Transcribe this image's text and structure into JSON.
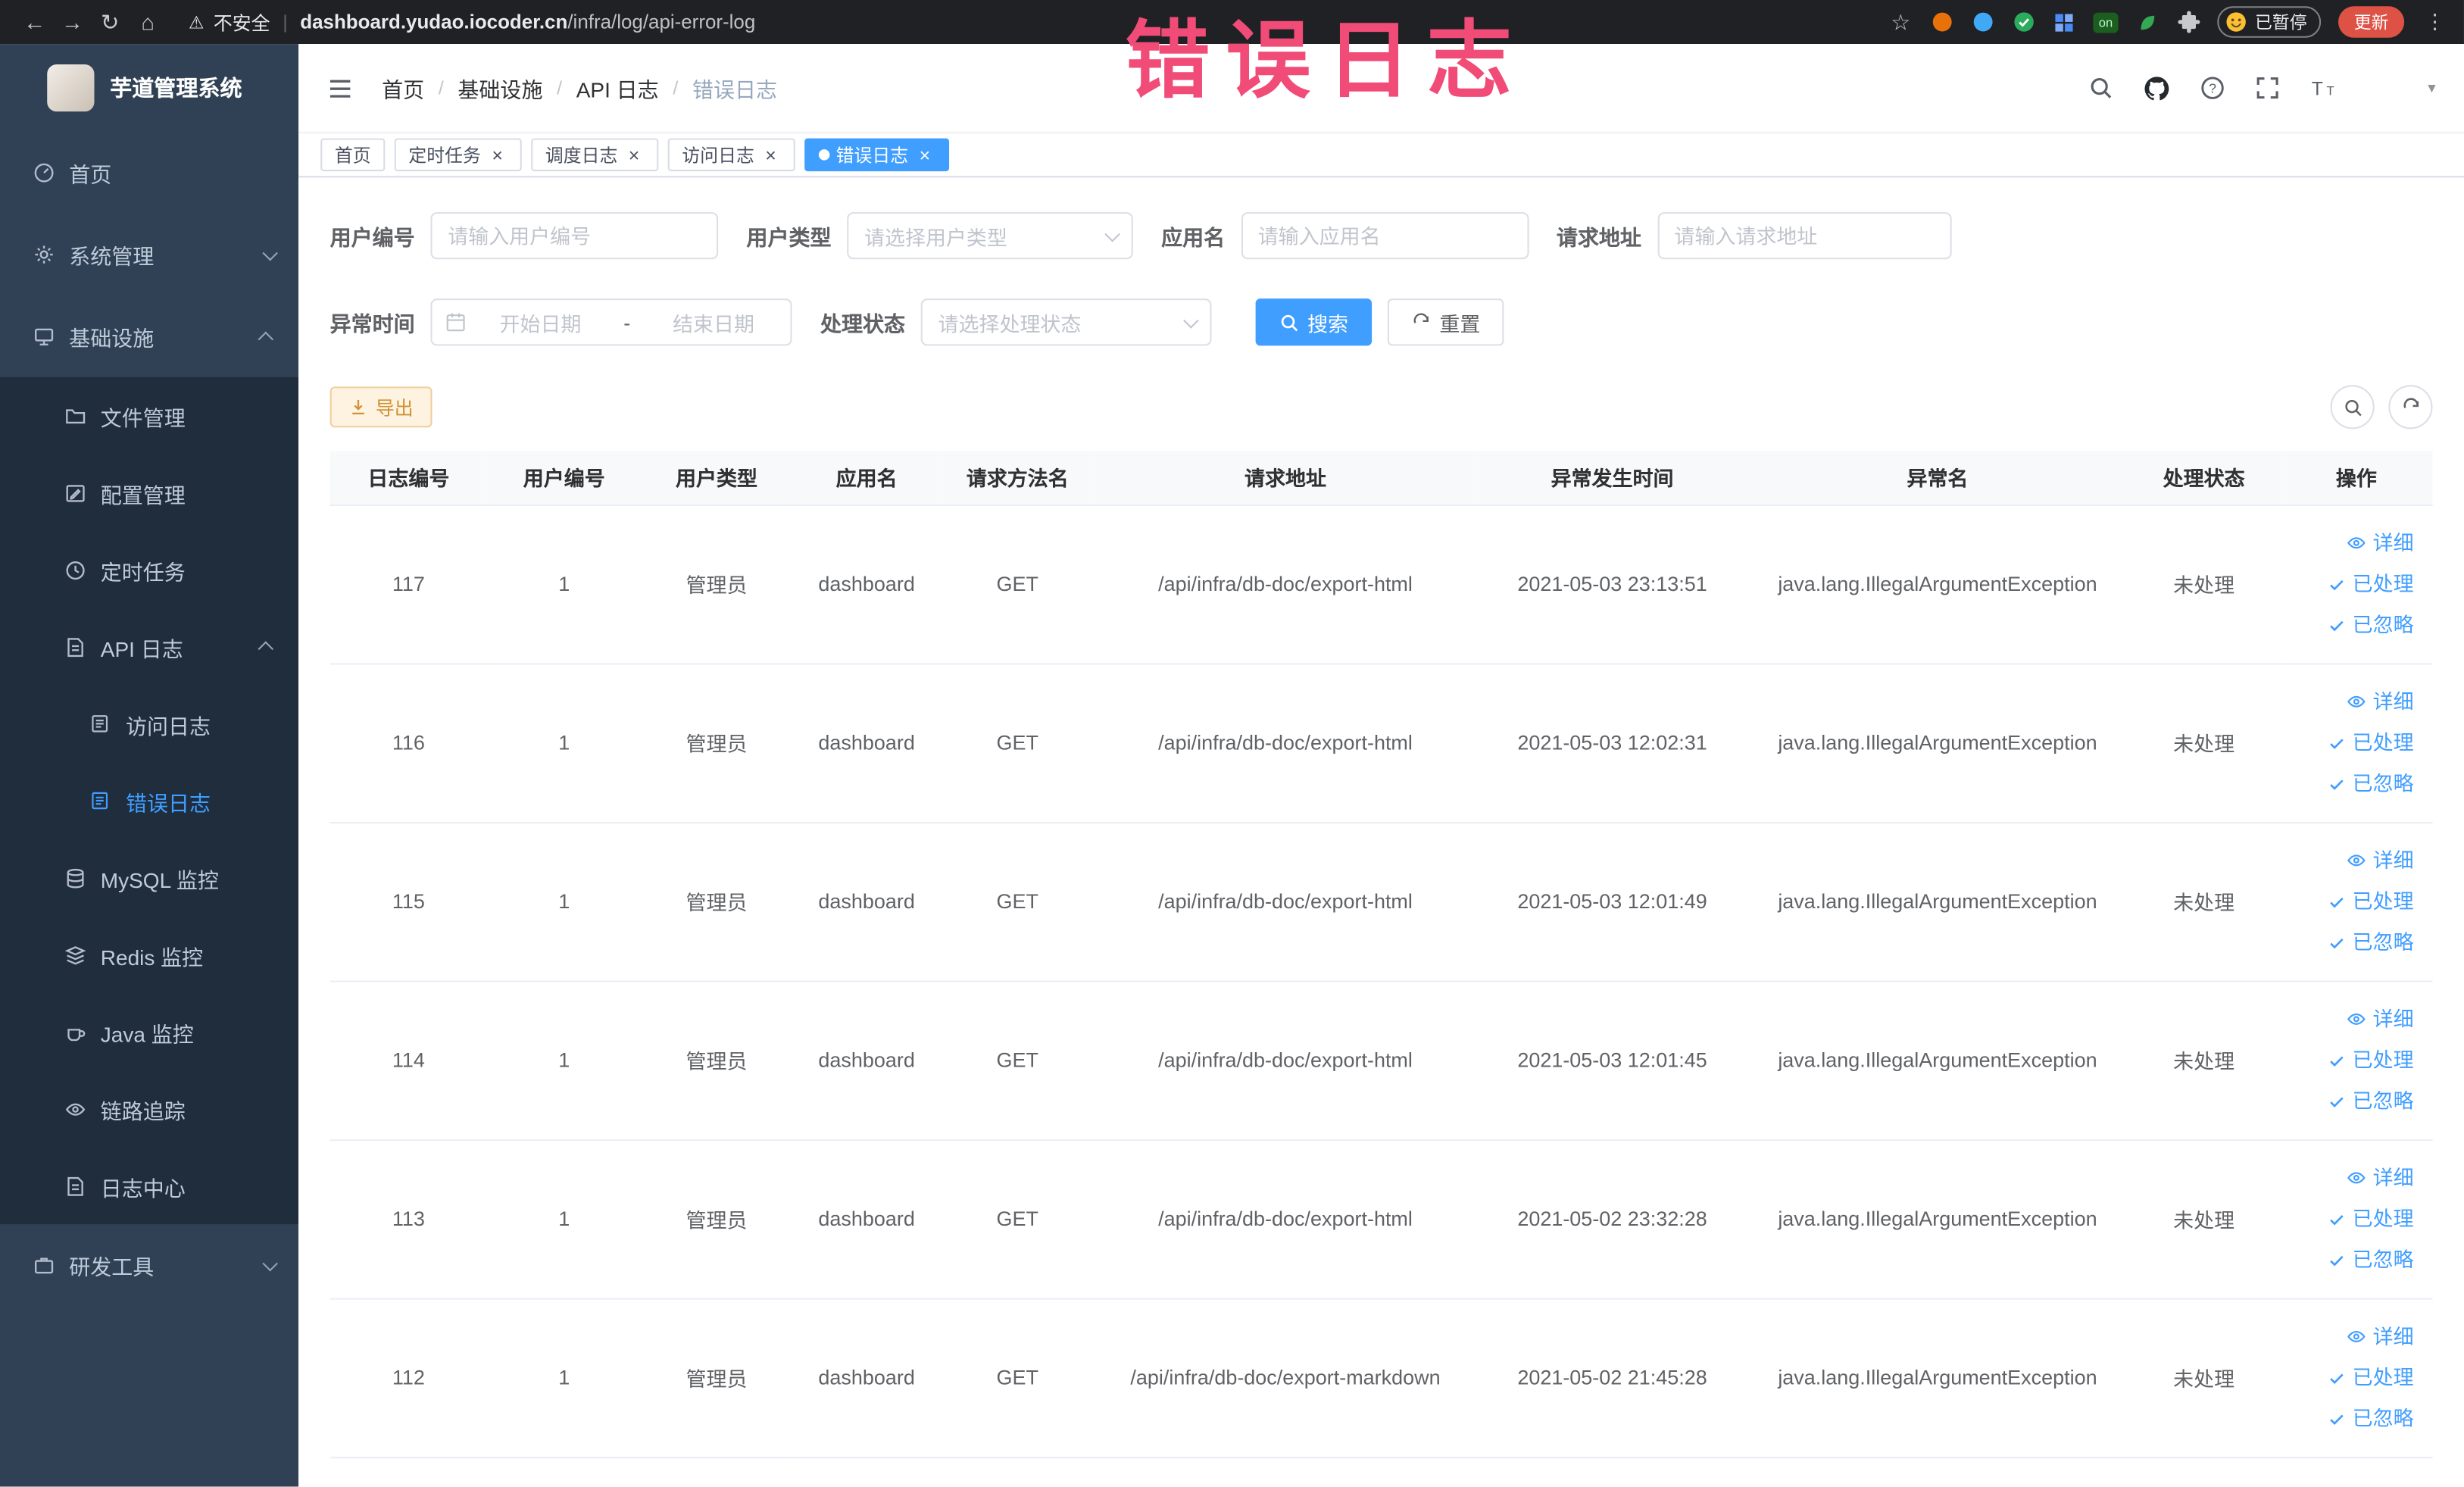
{
  "annotation": {
    "text": "错误日志"
  },
  "icons": {
    "back": "←",
    "forward": "→",
    "reload": "↻",
    "home": "⌂",
    "warning": "⚠",
    "star": "☆",
    "dots": "⋮",
    "close": "×",
    "caret": "▾",
    "on_badge": "on"
  },
  "browser": {
    "security_label": "不安全",
    "url_domain": "dashboard.yudao.iocoder.cn",
    "url_path": "/infra/log/api-error-log",
    "paused_badge": "已暂停",
    "update_button": "更新"
  },
  "sidebar": {
    "title": "芋道管理系统",
    "items": {
      "home": "首页",
      "system": "系统管理",
      "infra": "基础设施",
      "file": "文件管理",
      "config": "配置管理",
      "job": "定时任务",
      "api_log": "API 日志",
      "access_log": "访问日志",
      "error_log": "错误日志",
      "mysql": "MySQL 监控",
      "redis": "Redis 监控",
      "java": "Java 监控",
      "trace": "链路追踪",
      "log_center": "日志中心",
      "dev_tools": "研发工具"
    }
  },
  "breadcrumb": [
    "首页",
    "基础设施",
    "API 日志",
    "错误日志"
  ],
  "tabs": [
    {
      "label": "首页",
      "closable": false,
      "active": false
    },
    {
      "label": "定时任务",
      "closable": true,
      "active": false
    },
    {
      "label": "调度日志",
      "closable": true,
      "active": false
    },
    {
      "label": "访问日志",
      "closable": true,
      "active": false
    },
    {
      "label": "错误日志",
      "closable": true,
      "active": true
    }
  ],
  "filters": {
    "user_id": {
      "label": "用户编号",
      "placeholder": "请输入用户编号",
      "value": ""
    },
    "user_type": {
      "label": "用户类型",
      "placeholder": "请选择用户类型",
      "value": ""
    },
    "app_name": {
      "label": "应用名",
      "placeholder": "请输入应用名",
      "value": ""
    },
    "request_url": {
      "label": "请求地址",
      "placeholder": "请输入请求地址",
      "value": ""
    },
    "exception_time": {
      "label": "异常时间",
      "start_placeholder": "开始日期",
      "separator": "-",
      "end_placeholder": "结束日期"
    },
    "process_status": {
      "label": "处理状态",
      "placeholder": "请选择处理状态",
      "value": ""
    },
    "search_button": "搜索",
    "reset_button": "重置"
  },
  "toolbar": {
    "export_button": "导出"
  },
  "table": {
    "columns": [
      "日志编号",
      "用户编号",
      "用户类型",
      "应用名",
      "请求方法名",
      "请求地址",
      "异常发生时间",
      "异常名",
      "处理状态",
      "操作"
    ],
    "rows": [
      {
        "log_id": "117",
        "user_id": "1",
        "user_type": "管理员",
        "app_name": "dashboard",
        "method": "GET",
        "url": "/api/infra/db-doc/export-html",
        "time": "2021-05-03 23:13:51",
        "exception": "java.lang.IllegalArgumentException",
        "status": "未处理"
      },
      {
        "log_id": "116",
        "user_id": "1",
        "user_type": "管理员",
        "app_name": "dashboard",
        "method": "GET",
        "url": "/api/infra/db-doc/export-html",
        "time": "2021-05-03 12:02:31",
        "exception": "java.lang.IllegalArgumentException",
        "status": "未处理"
      },
      {
        "log_id": "115",
        "user_id": "1",
        "user_type": "管理员",
        "app_name": "dashboard",
        "method": "GET",
        "url": "/api/infra/db-doc/export-html",
        "time": "2021-05-03 12:01:49",
        "exception": "java.lang.IllegalArgumentException",
        "status": "未处理"
      },
      {
        "log_id": "114",
        "user_id": "1",
        "user_type": "管理员",
        "app_name": "dashboard",
        "method": "GET",
        "url": "/api/infra/db-doc/export-html",
        "time": "2021-05-03 12:01:45",
        "exception": "java.lang.IllegalArgumentException",
        "status": "未处理"
      },
      {
        "log_id": "113",
        "user_id": "1",
        "user_type": "管理员",
        "app_name": "dashboard",
        "method": "GET",
        "url": "/api/infra/db-doc/export-html",
        "time": "2021-05-02 23:32:28",
        "exception": "java.lang.IllegalArgumentException",
        "status": "未处理"
      },
      {
        "log_id": "112",
        "user_id": "1",
        "user_type": "管理员",
        "app_name": "dashboard",
        "method": "GET",
        "url": "/api/infra/db-doc/export-markdown",
        "time": "2021-05-02 21:45:28",
        "exception": "java.lang.IllegalArgumentException",
        "status": "未处理"
      }
    ]
  },
  "actions": {
    "detail": "详细",
    "processed": "已处理",
    "ignored": "已忽略"
  }
}
